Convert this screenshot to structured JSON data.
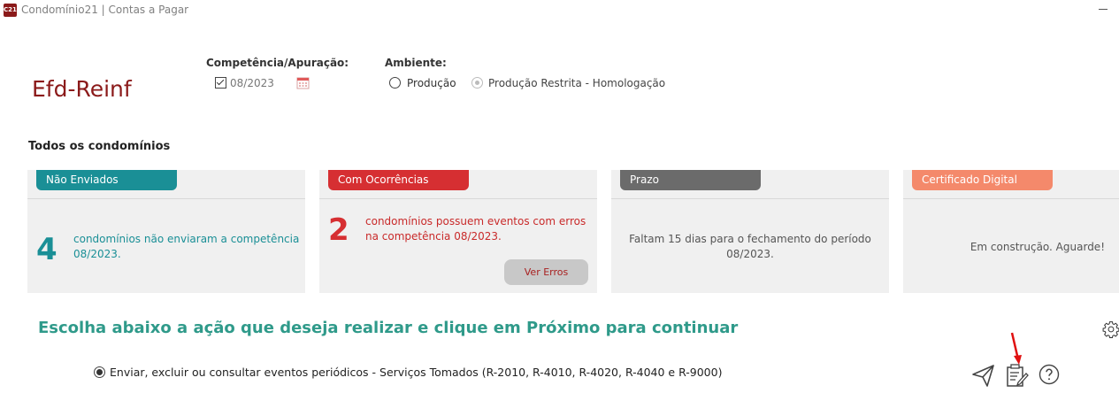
{
  "window": {
    "title": "Condomínio21 | Contas a Pagar",
    "icon_text": "C21"
  },
  "page": {
    "title": "Efd-Reinf"
  },
  "competencia": {
    "label": "Competência/Apuração:",
    "checked": true,
    "value": "08/2023"
  },
  "ambiente": {
    "label": "Ambiente:",
    "options": [
      {
        "label": "Produção",
        "selected": false,
        "enabled": true
      },
      {
        "label": "Produção Restrita - Homologação",
        "selected": true,
        "enabled": false
      }
    ]
  },
  "summary": {
    "section_label": "Todos os condomínios",
    "cards": [
      {
        "tab": "Não Enviados",
        "color": "#1a8f96",
        "count": "4",
        "text_line1": "condomínios não enviaram a competência",
        "text_line2": "08/2023."
      },
      {
        "tab": "Com Ocorrências",
        "color": "#d62f32",
        "count": "2",
        "text_line1": "condomínios possuem eventos com erros",
        "text_line2": "na competência 08/2023.",
        "button": "Ver Erros"
      },
      {
        "tab": "Prazo",
        "color": "#6b6b6b",
        "text_line1": "Faltam 15 dias para o fechamento do período",
        "text_line2": "08/2023."
      },
      {
        "tab": "Certificado Digital",
        "color": "#f4896b",
        "text_line1": "Em construção. Aguarde!"
      }
    ]
  },
  "actions": {
    "heading": "Escolha abaixo a ação que deseja realizar e clique em Próximo para continuar",
    "options": [
      {
        "label": "Enviar, excluir ou consultar eventos periódicos - Serviços Tomados (R-2010, R-4010, R-4020, R-4040 e R-9000)",
        "selected": true
      }
    ]
  },
  "icons": {
    "settings": "gear-icon",
    "send": "send-icon",
    "edit": "edit-document-icon",
    "help": "help-icon",
    "calendar": "calendar-icon"
  },
  "colors": {
    "brand": "#8b1a1a",
    "heading_teal": "#2f9a8a",
    "error_red": "#d62f32"
  }
}
